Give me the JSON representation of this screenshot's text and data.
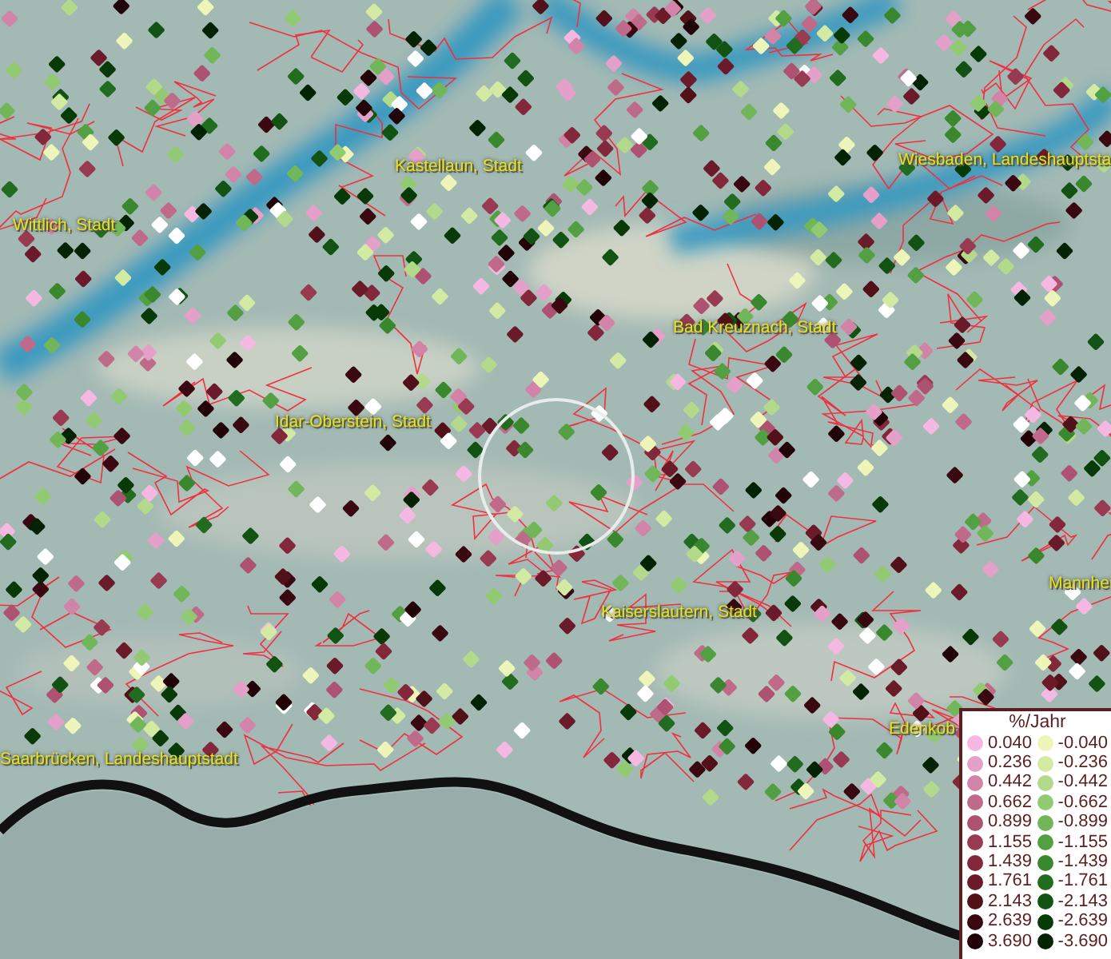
{
  "map": {
    "place_labels": [
      {
        "text": "Wittlich, Stadt"
      },
      {
        "text": "Kastellaun, Stadt"
      },
      {
        "text": "Wiesbaden, Landeshauptsta"
      },
      {
        "text": "Bad Kreuznach, Stadt"
      },
      {
        "text": "Idar-Oberstein, Stadt"
      },
      {
        "text": "Kaiserslautern, Stadt"
      },
      {
        "text": "Mannhei"
      },
      {
        "text": "Edenkob"
      },
      {
        "text": "Saarbrücken, Landeshauptstadt"
      }
    ]
  },
  "legend": {
    "title": "%/Jahr",
    "rows": [
      [
        {
          "value": "0.040",
          "color": "#f5b8e2"
        },
        {
          "value": "-0.040",
          "color": "#eef5b8"
        }
      ],
      [
        {
          "value": "0.236",
          "color": "#e4a0c8"
        },
        {
          "value": "-0.236",
          "color": "#d2eaa2"
        }
      ],
      [
        {
          "value": "0.442",
          "color": "#d284a8"
        },
        {
          "value": "-0.442",
          "color": "#b2da8a"
        }
      ],
      [
        {
          "value": "0.662",
          "color": "#c06a8a"
        },
        {
          "value": "-0.662",
          "color": "#92ca72"
        }
      ],
      [
        {
          "value": "0.899",
          "color": "#ae5272"
        },
        {
          "value": "-0.899",
          "color": "#72b65a"
        }
      ],
      [
        {
          "value": "1.155",
          "color": "#983a52"
        },
        {
          "value": "-1.155",
          "color": "#52a042"
        }
      ],
      [
        {
          "value": "1.439",
          "color": "#82283a"
        },
        {
          "value": "-1.439",
          "color": "#3a882e"
        }
      ],
      [
        {
          "value": "1.761",
          "color": "#6a1a28"
        },
        {
          "value": "-1.761",
          "color": "#226c20"
        }
      ],
      [
        {
          "value": "2.143",
          "color": "#521018"
        },
        {
          "value": "-2.143",
          "color": "#125212"
        }
      ],
      [
        {
          "value": "2.639",
          "color": "#3a0810"
        },
        {
          "value": "-2.639",
          "color": "#083a08"
        }
      ],
      [
        {
          "value": "3.690",
          "color": "#220408"
        },
        {
          "value": "-3.690",
          "color": "#042204"
        }
      ]
    ]
  }
}
